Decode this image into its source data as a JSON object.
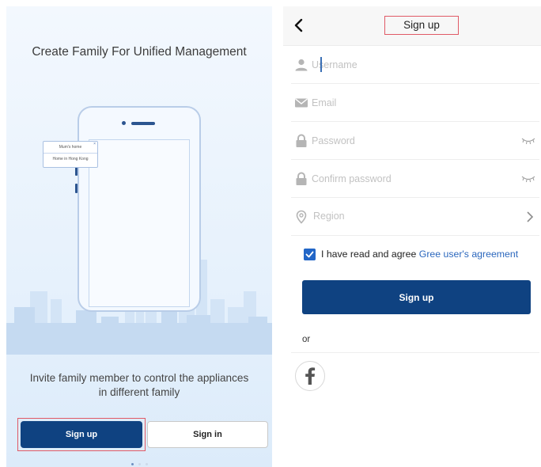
{
  "left": {
    "heading": "Create Family For Unified Management",
    "illustration": {
      "menu_items": [
        "Mum's home",
        "Home in Hong Kong"
      ],
      "menu_close_glyph": "×"
    },
    "invite_line1": "Invite family member to control the appliances",
    "invite_line2": "in different family",
    "signup_label": "Sign up",
    "signin_label": "Sign in",
    "pager": {
      "pages": 3,
      "active": 1
    }
  },
  "right": {
    "header": {
      "title": "Sign up",
      "back_icon": "chevron-left-icon"
    },
    "fields": {
      "username": {
        "placeholder": "Username",
        "icon": "user-icon"
      },
      "email": {
        "placeholder": "Email",
        "icon": "mail-icon"
      },
      "password": {
        "placeholder": "Password",
        "icon": "lock-icon",
        "toggle_icon": "eye-closed-icon"
      },
      "confirm_password": {
        "placeholder": "Confirm password",
        "icon": "lock-icon",
        "toggle_icon": "eye-closed-icon"
      },
      "region": {
        "label": "Region",
        "icon": "location-pin-icon",
        "trailing_icon": "chevron-right-icon"
      }
    },
    "agree": {
      "checked": true,
      "text": "I have read and agree ",
      "link": "Gree user's agreement"
    },
    "signup_label": "Sign up",
    "or_label": "or",
    "social": {
      "facebook_glyph": "f",
      "icon": "facebook-icon"
    }
  },
  "colors": {
    "primary": "#0f4281",
    "link": "#2b67bd",
    "checkbox": "#2266c7",
    "highlight": "#e05a66",
    "placeholder": "#c2c2c2",
    "illustration_bg": "#e6f1fc"
  }
}
